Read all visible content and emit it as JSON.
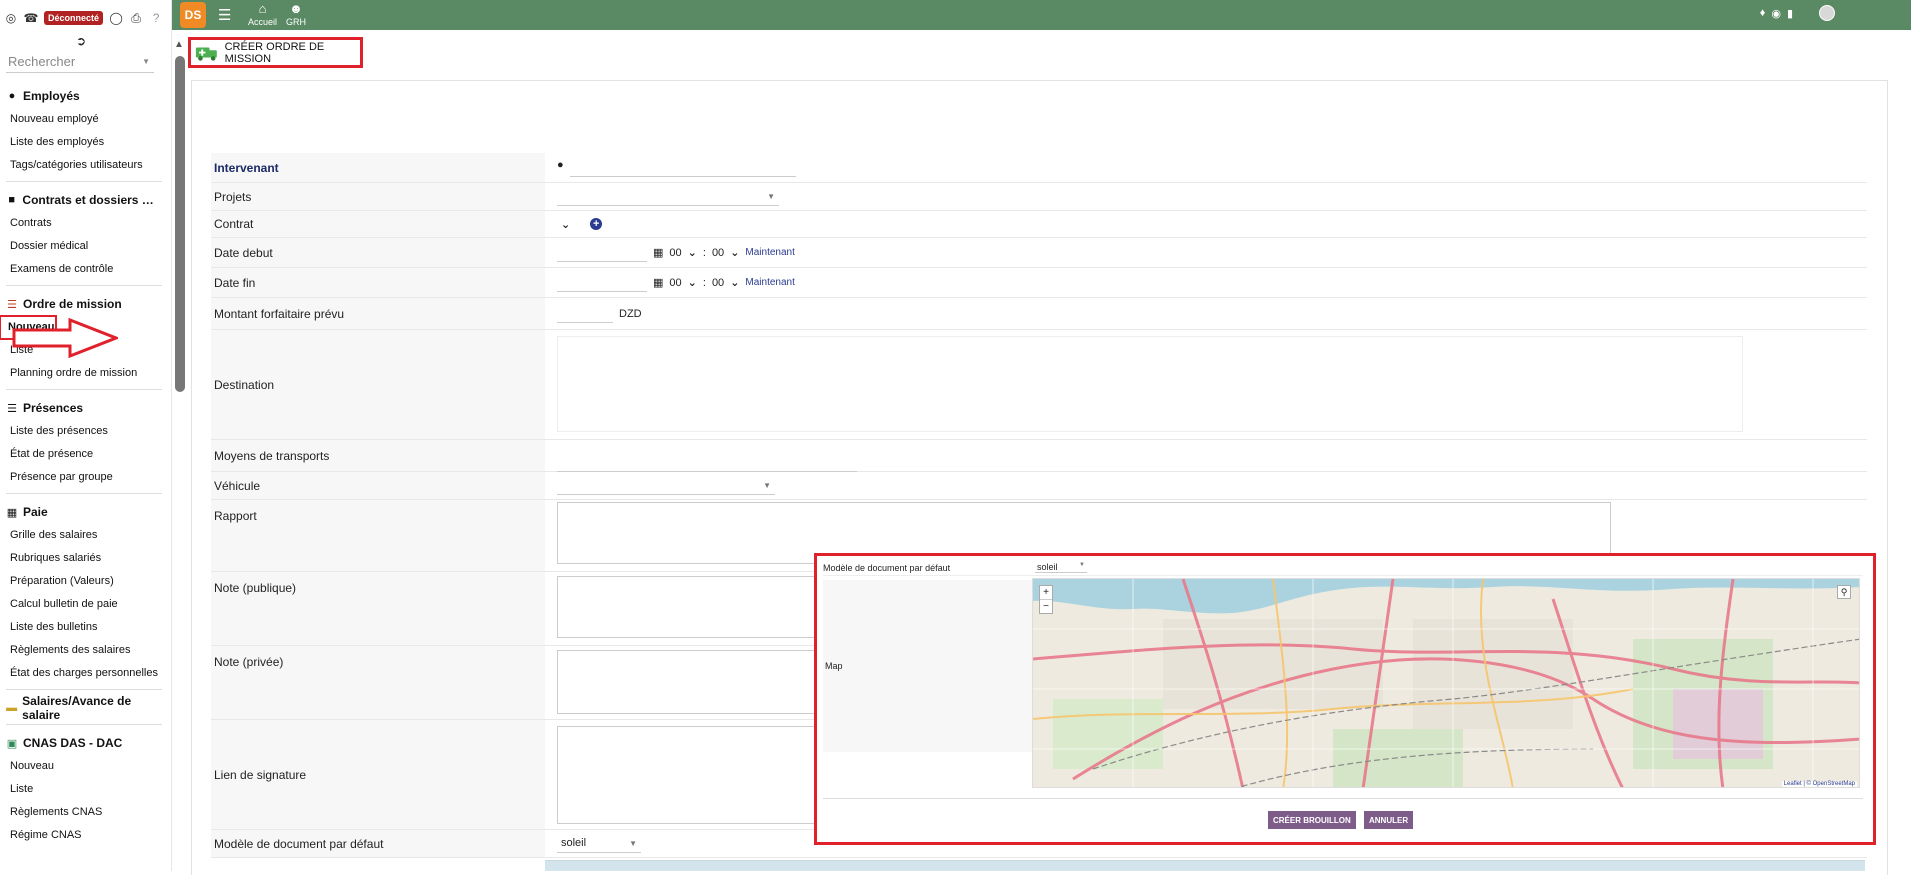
{
  "sidebar": {
    "status_badge": "Déconnecté",
    "search_placeholder": "Rechercher",
    "sections": [
      {
        "title": "Employés",
        "icon": "user-icon",
        "items": [
          "Nouveau employé",
          "Liste des employés",
          "Tags/catégories utilisateurs"
        ]
      },
      {
        "title": "Contrats et dossiers mé...",
        "icon": "folder-icon",
        "items": [
          "Contrats",
          "Dossier médical",
          "Examens de contrôle"
        ]
      },
      {
        "title": "Ordre de mission",
        "icon": "list-icon",
        "items": [
          "Nouveau",
          "Liste",
          "Planning ordre de mission"
        ]
      },
      {
        "title": "Présences",
        "icon": "list-icon",
        "items": [
          "Liste des présences",
          "État de présence",
          "Présence par groupe"
        ]
      },
      {
        "title": "Paie",
        "icon": "money-icon",
        "items": [
          "Grille des salaires",
          "Rubriques salariés",
          "Préparation (Valeurs)",
          "Calcul bulletin de paie",
          "Liste des bulletins",
          "Règlements des salaires",
          "État des charges personnelles"
        ]
      },
      {
        "title": "Salaires/Avance de salaire",
        "icon": "wallet-icon",
        "items": []
      },
      {
        "title": "CNAS DAS - DAC",
        "icon": "document-icon",
        "items": [
          "Nouveau",
          "Liste",
          "Règlements CNAS",
          "Régime CNAS"
        ]
      }
    ]
  },
  "topbar": {
    "logo": "DS",
    "nav": [
      {
        "label": "Accueil",
        "icon": "home-icon"
      },
      {
        "label": "GRH",
        "icon": "user-icon"
      }
    ]
  },
  "page": {
    "title": "CRÉER ORDRE DE MISSION"
  },
  "form": {
    "intervenant": "Intervenant",
    "projets": "Projets",
    "contrat": "Contrat",
    "date_debut": "Date debut",
    "date_fin": "Date fin",
    "hour": "00",
    "minute": "00",
    "now": "Maintenant",
    "montant": "Montant forfaitaire prévu",
    "currency": "DZD",
    "destination": "Destination",
    "moyens": "Moyens de transports",
    "vehicule": "Véhicule",
    "rapport": "Rapport",
    "note_publique": "Note (publique)",
    "note_privee": "Note (privée)",
    "lien_signature": "Lien de signature",
    "modele": "Modèle de document par défaut",
    "modele_value": "soleil"
  },
  "modal": {
    "modele_label": "Modèle de document par défaut",
    "modele_value": "soleil",
    "map_label": "Map",
    "attribution": "Leaflet | © OpenStreetMap",
    "btn_create": "CRÉER BROUILLON",
    "btn_cancel": "ANNULER"
  },
  "colors": {
    "topbar": "#5a8a63",
    "accent": "#7e5c8a",
    "highlight": "#e0202a"
  }
}
